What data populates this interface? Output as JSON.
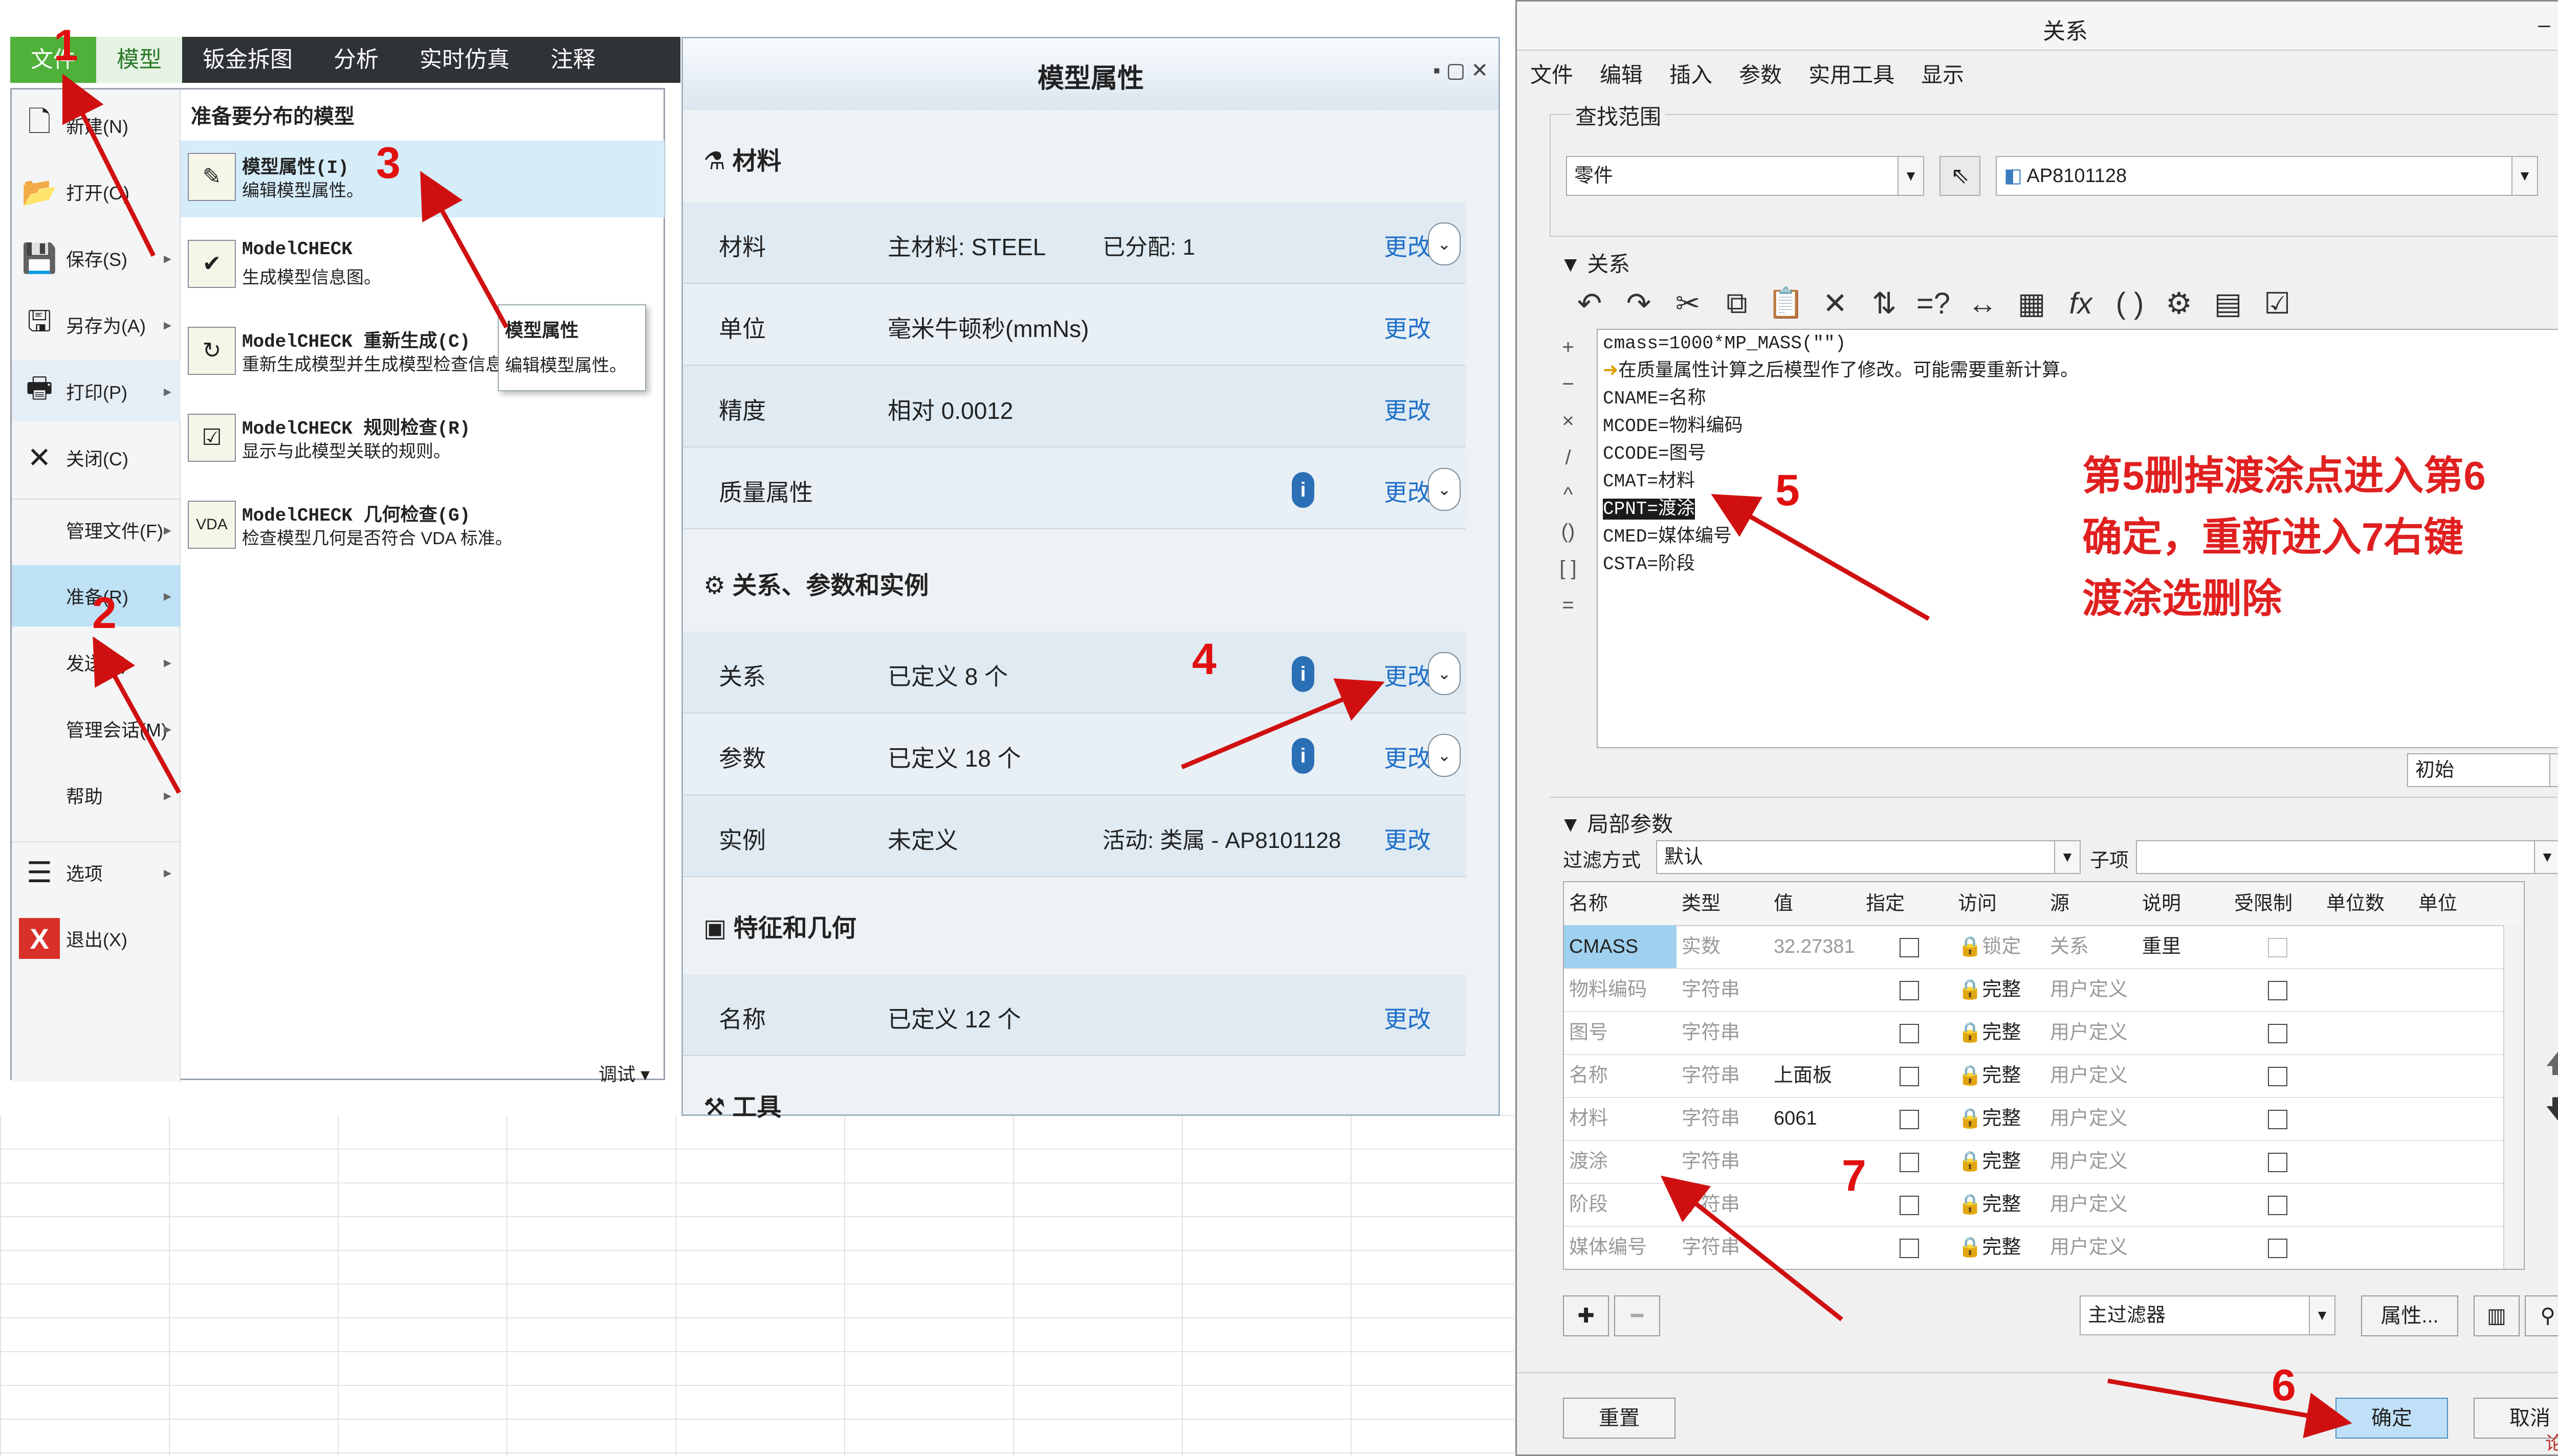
{
  "panel1": {
    "tabs": [
      "文件",
      "模型",
      "钣金拆图",
      "分析",
      "实时仿真",
      "注释"
    ],
    "menu_left": [
      {
        "label": "新建(N)",
        "icon": "new-doc-icon",
        "arrow": false
      },
      {
        "label": "打开(O)",
        "icon": "folder-icon",
        "arrow": false
      },
      {
        "label": "保存(S)",
        "icon": "save-icon",
        "arrow": true
      },
      {
        "label": "另存为(A)",
        "icon": "save-as-icon",
        "arrow": true
      },
      {
        "label": "打印(P)",
        "icon": "print-icon",
        "arrow": true
      },
      {
        "label": "关闭(C)",
        "icon": "close-icon",
        "arrow": false
      },
      {
        "label": "管理文件(F)",
        "icon": "",
        "arrow": true
      },
      {
        "label": "准备(R)",
        "icon": "",
        "arrow": true
      },
      {
        "label": "发送(S)",
        "icon": "",
        "arrow": true
      },
      {
        "label": "管理会话(M)",
        "icon": "",
        "arrow": true
      },
      {
        "label": "帮助",
        "icon": "",
        "arrow": true
      },
      {
        "label": "选项",
        "icon": "options-icon",
        "arrow": true
      },
      {
        "label": "退出(X)",
        "icon": "exit-icon",
        "arrow": false
      }
    ],
    "right_header": "准备要分布的模型",
    "right_items": [
      {
        "title": "模型属性(I)",
        "desc": "编辑模型属性。"
      },
      {
        "title": "ModelCHECK",
        "desc": "生成模型信息图。"
      },
      {
        "title": "ModelCHECK 重新生成(C)",
        "desc": "重新生成模型并生成模型检查信息报告。"
      },
      {
        "title": "ModelCHECK 规则检查(R)",
        "desc": "显示与此模型关联的规则。"
      },
      {
        "title": "ModelCHECK 几何检查(G)",
        "desc": "检查模型几何是否符合 VDA 标准。"
      }
    ],
    "tooltip_title": "模型属性",
    "tooltip_desc": "编辑模型属性。",
    "debug": "调试 ▾"
  },
  "panel2": {
    "title": "模型属性",
    "sections": {
      "material": "材料",
      "relations": "关系、参数和实例",
      "features": "特征和几何",
      "tools": "工具"
    },
    "rows": [
      {
        "label": "材料",
        "value": "主材料: STEEL",
        "value2": "已分配: 1",
        "edit": "更改"
      },
      {
        "label": "单位",
        "value": "毫米牛顿秒(mmNs)",
        "value2": "",
        "edit": "更改"
      },
      {
        "label": "精度",
        "value": "相对 0.0012",
        "value2": "",
        "edit": "更改"
      },
      {
        "label": "质量属性",
        "value": "",
        "value2": "",
        "edit": "更改"
      },
      {
        "label": "关系",
        "value": "已定义 8 个",
        "value2": "",
        "edit": "更改"
      },
      {
        "label": "参数",
        "value": "已定义 18 个",
        "value2": "",
        "edit": "更改"
      },
      {
        "label": "实例",
        "value": "未定义",
        "value2": "活动: 类属 - AP8101128",
        "edit": "更改"
      },
      {
        "label": "名称",
        "value": "已定义 12 个",
        "value2": "",
        "edit": "更改"
      }
    ]
  },
  "panel3": {
    "title": "关系",
    "menu": [
      "文件",
      "编辑",
      "插入",
      "参数",
      "实用工具",
      "显示"
    ],
    "search_scope": "查找范围",
    "scope_value": "零件",
    "model_value": "AP8101128",
    "relations_header": "关系",
    "side_symbols": [
      "+",
      "−",
      "×",
      "/",
      "^",
      "()",
      "[ ]",
      "="
    ],
    "relations_lines": [
      "cmass=1000*MP_MASS(\"\")",
      "在质量属性计算之后模型作了修改。可能需要重新计算。",
      "CNAME=名称",
      "MCODE=物料编码",
      "CCODE=图号",
      "CMAT=材料",
      "CPNT=渡涂",
      "CMED=媒体编号",
      "CSTA=阶段"
    ],
    "init_combo": "初始",
    "local_params": "局部参数",
    "filter_label": "过滤方式",
    "filter_value": "默认",
    "subitem_label": "子项",
    "columns": [
      "名称",
      "类型",
      "值",
      "指定",
      "访问",
      "源",
      "说明",
      "受限制",
      "单位数",
      "单位"
    ],
    "params": [
      {
        "name": "CMASS",
        "type": "实数",
        "value": "32.27381",
        "access": "锁定",
        "source": "关系",
        "note": "重里"
      },
      {
        "name": "物料编码",
        "type": "字符串",
        "value": "",
        "access": "完整",
        "source": "用户定义",
        "note": ""
      },
      {
        "name": "图号",
        "type": "字符串",
        "value": "",
        "access": "完整",
        "source": "用户定义",
        "note": ""
      },
      {
        "name": "名称",
        "type": "字符串",
        "value": "上面板",
        "access": "完整",
        "source": "用户定义",
        "note": ""
      },
      {
        "name": "材料",
        "type": "字符串",
        "value": "6061",
        "access": "完整",
        "source": "用户定义",
        "note": ""
      },
      {
        "name": "渡涂",
        "type": "字符串",
        "value": "",
        "access": "完整",
        "source": "用户定义",
        "note": ""
      },
      {
        "name": "阶段",
        "type": "字符串",
        "value": "",
        "access": "完整",
        "source": "用户定义",
        "note": ""
      },
      {
        "name": "媒体编号",
        "type": "字符串",
        "value": "",
        "access": "完整",
        "source": "用户定义",
        "note": ""
      }
    ],
    "main_filter": "主过滤器",
    "props_button": "属性...",
    "reset_button": "重置",
    "ok_button": "确定",
    "cancel_button": "取消",
    "watermark": "论坛"
  },
  "annotation": {
    "note": "第5删掉渡涂点进入第6确定，重新进入7右键渡涂选删除",
    "note_lines": [
      "第5删掉渡涂点进入第6",
      "确定，重新进入7右键",
      "渡涂选删除"
    ],
    "numbers": [
      "1",
      "2",
      "3",
      "4",
      "5",
      "6",
      "7"
    ],
    "color": "#e01010"
  }
}
